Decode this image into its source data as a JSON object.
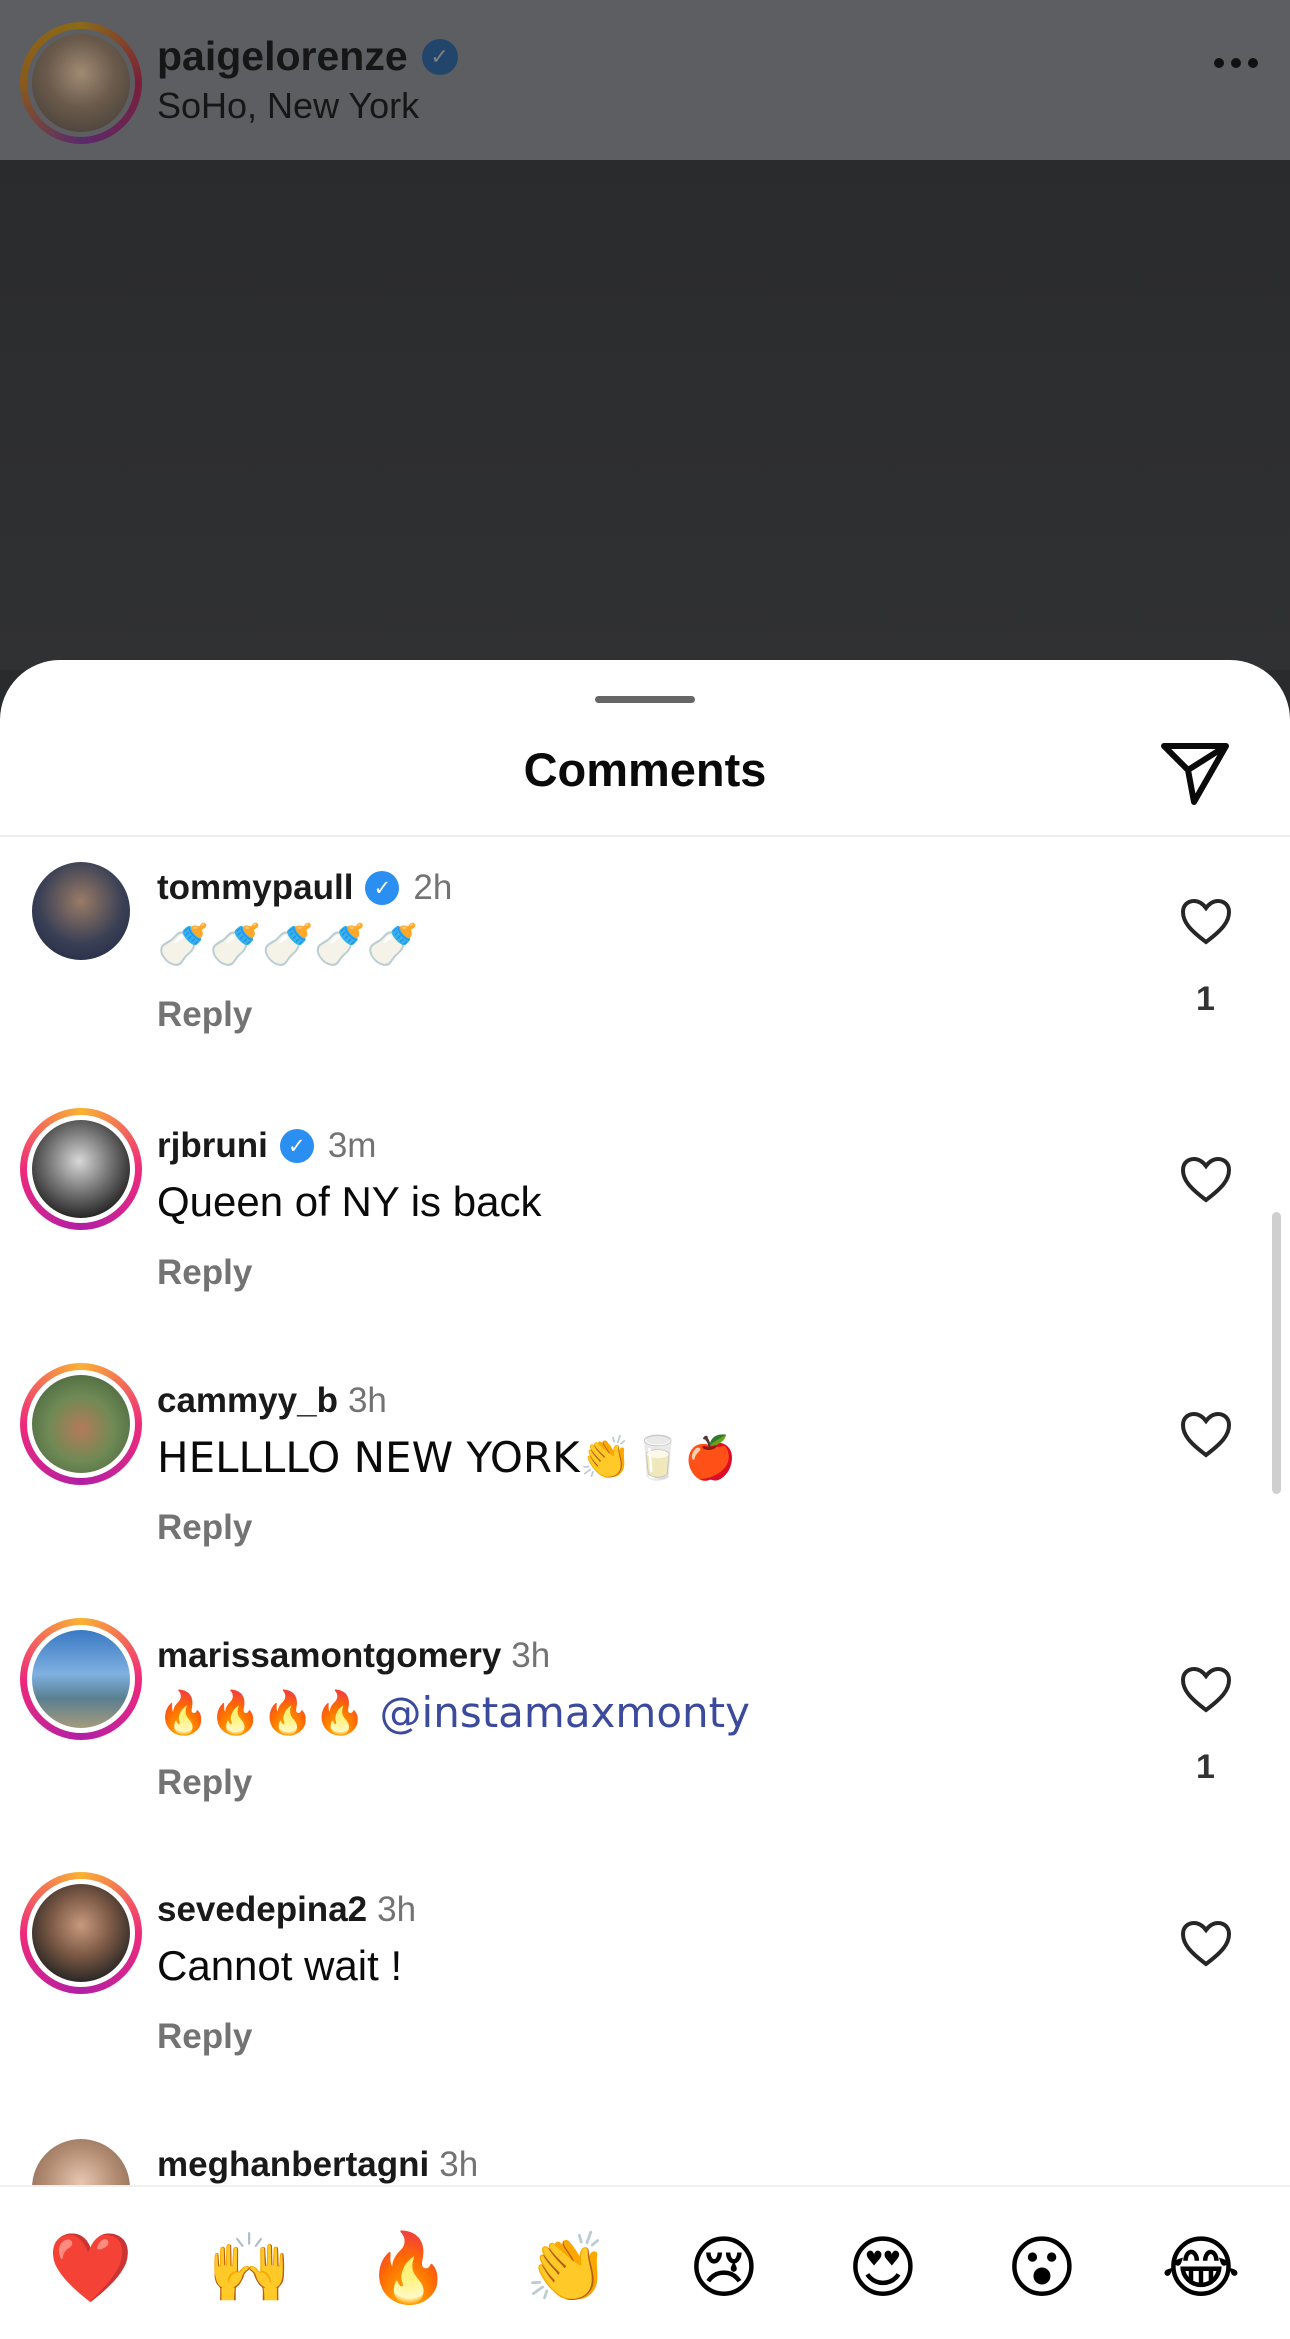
{
  "post": {
    "username": "paigelorenze",
    "location": "SoHo, New York",
    "more_icon": "more-horizontal-icon"
  },
  "sheet": {
    "title": "Comments",
    "share_icon": "paper-plane-icon"
  },
  "comments": [
    {
      "username": "tommypaull",
      "verified": true,
      "time": "2h",
      "text": "🍼🍼🍼🍼🍼",
      "reply": "Reply",
      "likes": "1"
    },
    {
      "username": "rjbruni",
      "verified": true,
      "time": "3m",
      "text": "Queen of NY is back",
      "reply": "Reply",
      "likes": ""
    },
    {
      "username": "cammyy_b",
      "verified": false,
      "time": "3h",
      "text": "HELLLLO NEW YORK👏🥛🍎",
      "reply": "Reply",
      "likes": ""
    },
    {
      "username": "marissamontgomery",
      "verified": false,
      "time": "3h",
      "text": "🔥🔥🔥🔥 ",
      "mention": "@instamaxmonty",
      "reply": "Reply",
      "likes": "1"
    },
    {
      "username": "sevedepina2",
      "verified": false,
      "time": "3h",
      "text": "Cannot wait !",
      "reply": "Reply",
      "likes": ""
    },
    {
      "username": "meghanbertagni",
      "verified": false,
      "time": "3h",
      "text": "",
      "reply": "",
      "likes": ""
    }
  ],
  "reactions": [
    "❤️",
    "🙌",
    "🔥",
    "👏",
    "😢",
    "😍",
    "😮",
    "😂"
  ],
  "colors": {
    "verified_blue": "#2a8ff0",
    "mention": "#3b4a9c",
    "muted_text": "#737373",
    "dim_overlay": "#5d5e61"
  }
}
